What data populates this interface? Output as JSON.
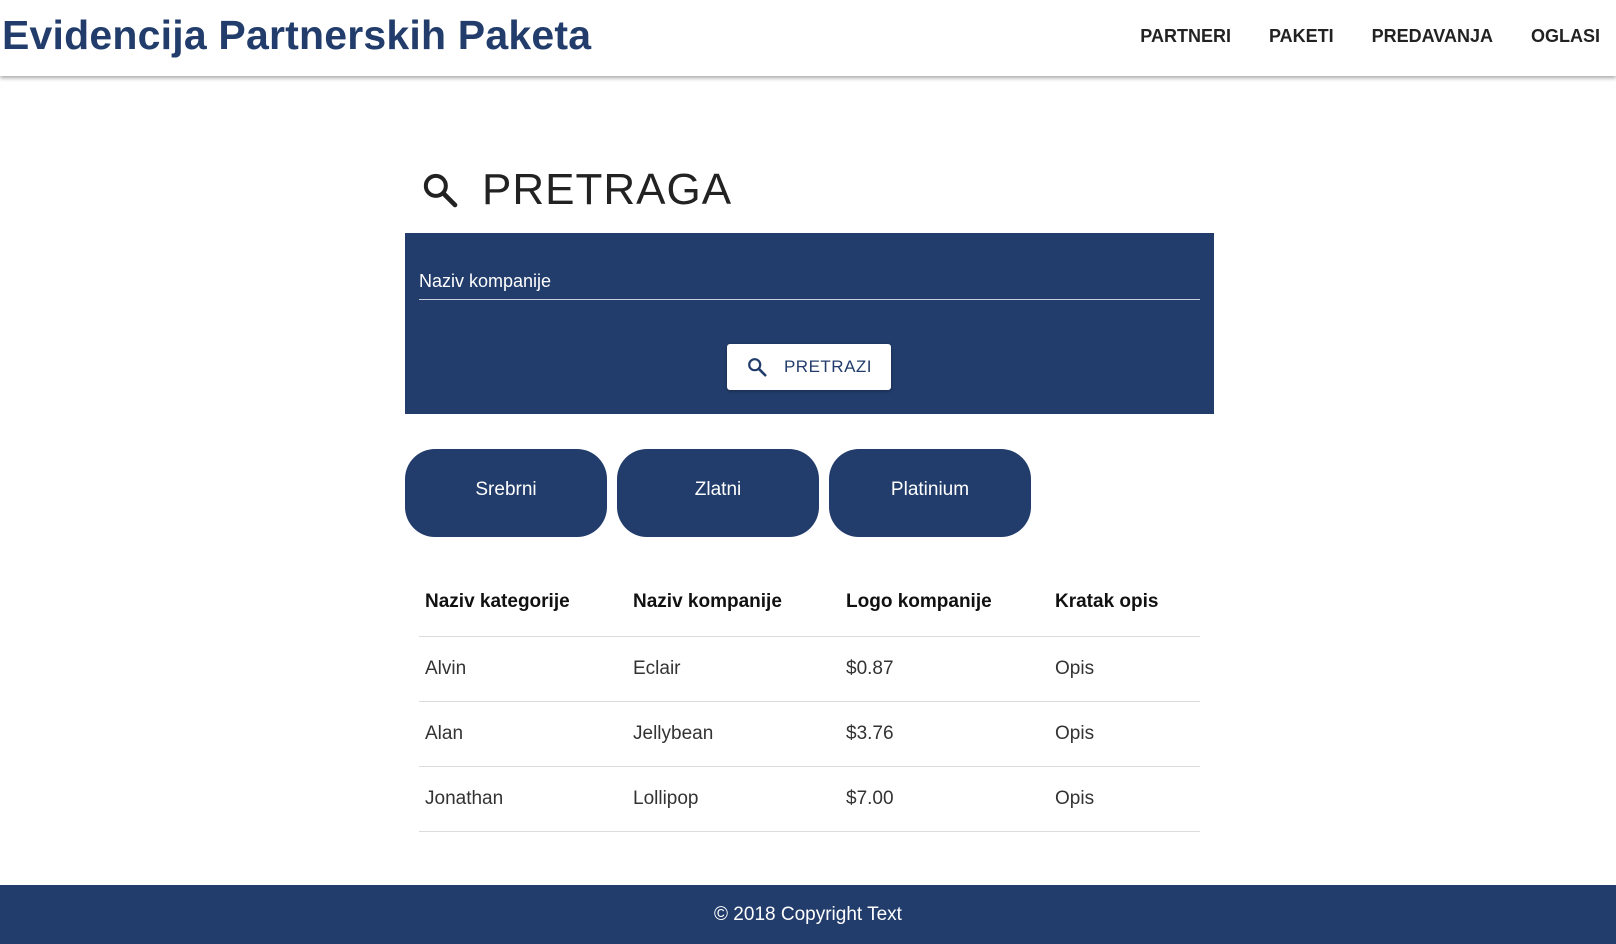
{
  "header": {
    "title": "Evidencija Partnerskih Paketa",
    "nav": [
      "PARTNERI",
      "PAKETI",
      "PREDAVANJA",
      "OGLASI"
    ]
  },
  "search": {
    "heading": "PRETRAGA",
    "icon": "search-icon",
    "placeholder": "Naziv kompanije",
    "value": "",
    "button_label": "PRETRAZI"
  },
  "packages": [
    "Srebrni",
    "Zlatni",
    "Platinium"
  ],
  "table": {
    "columns": [
      "Naziv kategorije",
      "Naziv kompanije",
      "Logo kompanije",
      "Kratak opis"
    ],
    "rows": [
      [
        "Alvin",
        "Eclair",
        "$0.87",
        "Opis"
      ],
      [
        "Alan",
        "Jellybean",
        "$3.76",
        "Opis"
      ],
      [
        "Jonathan",
        "Lollipop",
        "$7.00",
        "Opis"
      ]
    ]
  },
  "footer": {
    "text": "© 2018 Copyright Text"
  },
  "colors": {
    "primary": "#223d6b",
    "background": "#ffffff"
  }
}
